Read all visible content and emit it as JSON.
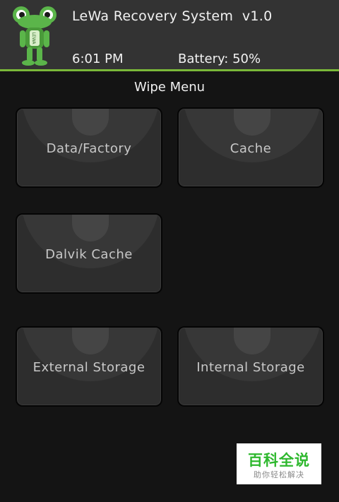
{
  "header": {
    "title": "LeWa Recovery System  v1.0",
    "time": "6:01 PM",
    "battery": "Battery: 50%",
    "logo_text": "LEWA"
  },
  "menu": {
    "title": "Wipe Menu",
    "buttons": [
      {
        "label": "Data/Factory"
      },
      {
        "label": "Cache"
      },
      {
        "label": "Dalvik Cache"
      },
      {
        "label": "External Storage"
      },
      {
        "label": "Internal Storage"
      }
    ]
  },
  "watermark": {
    "title": "百科全说",
    "subtitle": "助你轻松解决"
  },
  "colors": {
    "accent": "#7ab839",
    "header_bg": "#333333",
    "page_bg": "#141414",
    "tile_bg": "#2d2d2d"
  }
}
